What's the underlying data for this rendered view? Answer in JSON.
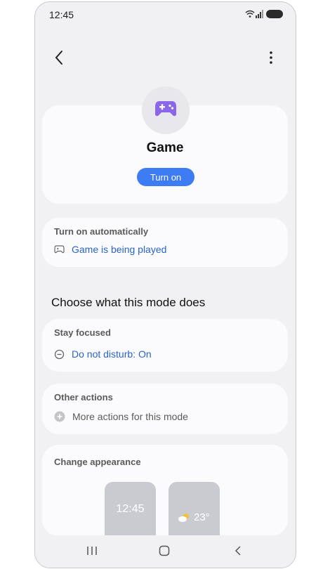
{
  "status": {
    "time": "12:45"
  },
  "mode": {
    "title": "Game",
    "turn_on_label": "Turn on"
  },
  "auto": {
    "label": "Turn on automatically",
    "trigger": "Game is being played"
  },
  "section_heading": "Choose what this mode does",
  "focus": {
    "label": "Stay focused",
    "dnd": "Do not disturb: On"
  },
  "other": {
    "label": "Other actions",
    "more": "More actions for this mode"
  },
  "appearance": {
    "label": "Change appearance",
    "lock_time": "12:45",
    "temperature": "23°"
  },
  "colors": {
    "accent": "#3e7cf4",
    "link": "#2a64c6",
    "game_icon": "#8a66e8"
  },
  "icons": [
    "back-icon",
    "more-options-icon",
    "gamepad-icon",
    "minus-circle-icon",
    "plus-circle-icon",
    "weather-icon"
  ]
}
